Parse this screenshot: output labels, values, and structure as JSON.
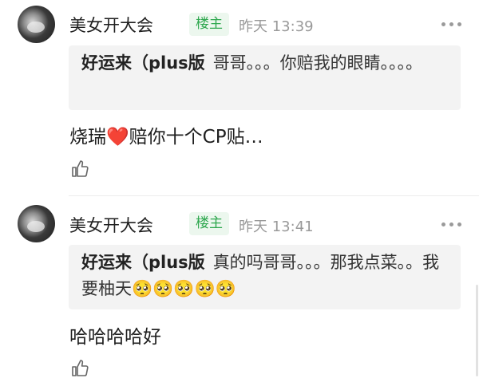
{
  "comments": [
    {
      "author": "美女开大会",
      "badge": "楼主",
      "time": "昨天 13:39",
      "quote": {
        "author": "好运来（plus版",
        "text": "哥哥。。。你赔我的眼睛。。。。"
      },
      "body_prefix": "烧瑞",
      "body_heart": "❤️",
      "body_suffix": "赔你十个CP贴…"
    },
    {
      "author": "美女开大会",
      "badge": "楼主",
      "time": "昨天 13:41",
      "quote": {
        "author": "好运来（plus版",
        "text": "真的吗哥哥。。。那我点菜。。我要柚天🥺🥺🥺🥺🥺"
      },
      "body": "哈哈哈哈好"
    }
  ],
  "icons": {
    "more": "more-dots-icon",
    "like": "thumbs-up-icon"
  },
  "colors": {
    "badge_bg": "#ecf7ee",
    "badge_text": "#2fa84f",
    "time": "#999999",
    "quote_bg": "#f3f3f3",
    "heart": "#e8242b"
  }
}
